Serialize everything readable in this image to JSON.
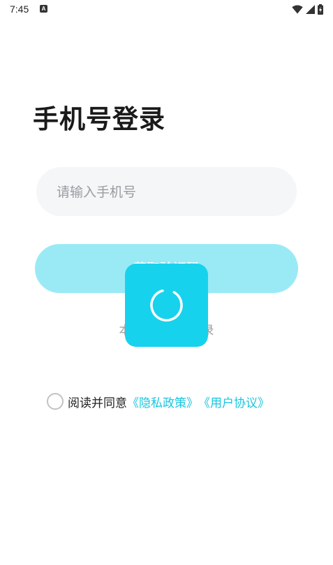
{
  "status_bar": {
    "time": "7:45",
    "notification_icon": "A"
  },
  "login": {
    "title": "手机号登录",
    "phone_placeholder": "请输入手机号",
    "get_code_label": "获取验证码",
    "one_key_login_label": "本机号码一键登录"
  },
  "agreement": {
    "prefix": "阅读并同意",
    "privacy_policy": "《隐私政策》",
    "user_agreement": "《用户协议》"
  },
  "colors": {
    "accent": "#17d2ec",
    "button_disabled": "#9aeaf6",
    "link": "#17c6df"
  },
  "icons": [
    "wifi-icon",
    "signal-icon",
    "battery-charging-icon",
    "spinner-icon"
  ]
}
